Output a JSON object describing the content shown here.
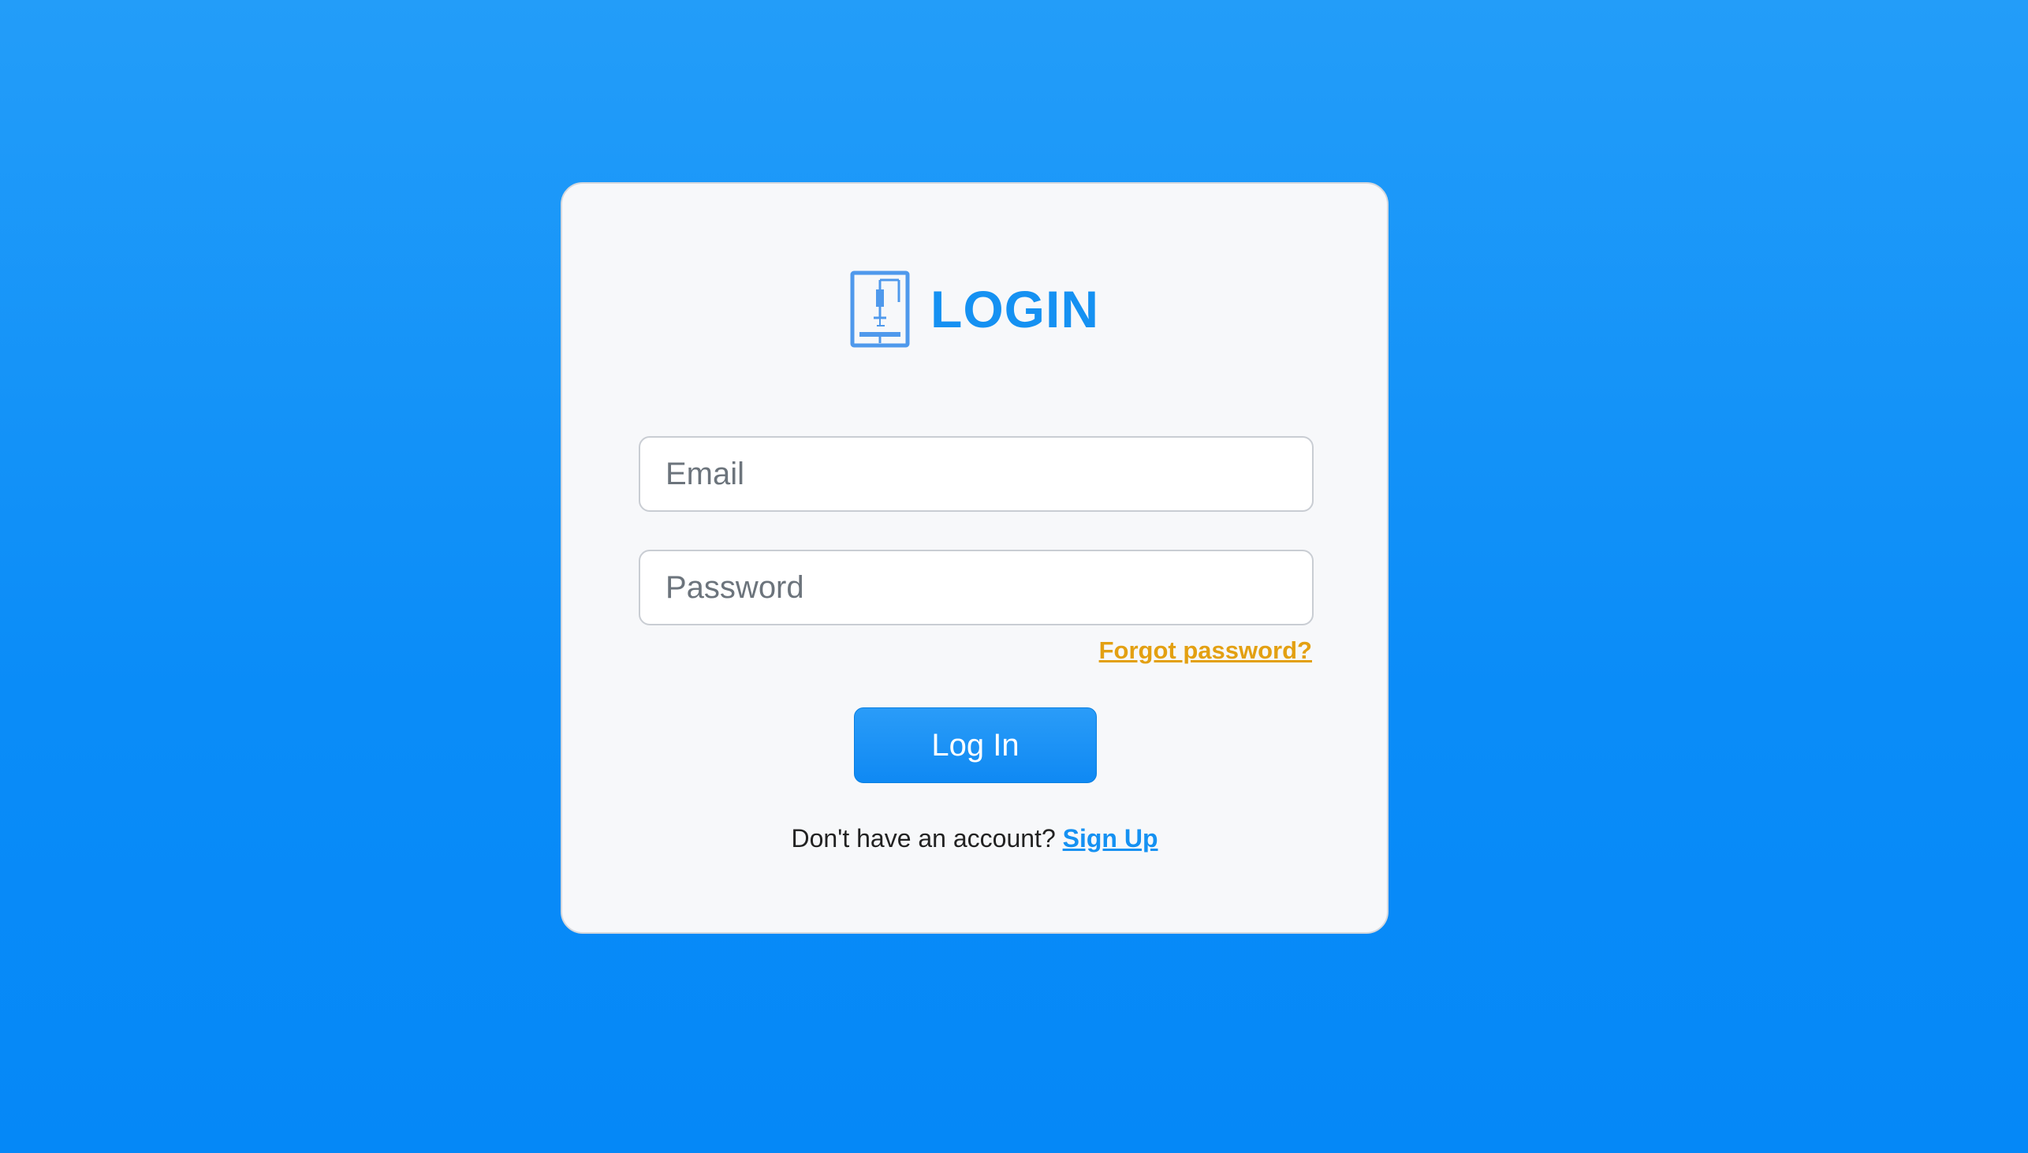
{
  "header": {
    "icon": "3d-printer-icon",
    "title": "LOGIN"
  },
  "form": {
    "email_placeholder": "Email",
    "password_placeholder": "Password",
    "forgot_label": "Forgot password?",
    "submit_label": "Log In"
  },
  "footer": {
    "prompt": "Don't have an account?",
    "signup_label": "Sign Up"
  },
  "colors": {
    "background": "#0a8cf8",
    "accent": "#1591f2",
    "link_forgot": "#e3a012",
    "card": "#f7f8fa"
  }
}
